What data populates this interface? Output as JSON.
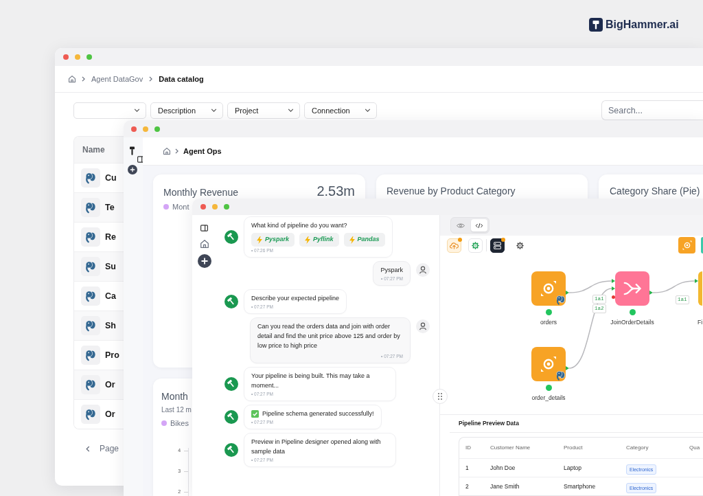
{
  "brand": {
    "name": "BigHammer.ai"
  },
  "data_catalog_window": {
    "breadcrumb": [
      {
        "label": "Agent DataGov",
        "current": false
      },
      {
        "label": "Data catalog",
        "current": true
      }
    ],
    "filters": [
      {
        "kind": "blank"
      },
      {
        "kind": "labeled",
        "label": "Description"
      },
      {
        "kind": "labeled",
        "label": "Project"
      },
      {
        "kind": "labeled",
        "label": "Connection"
      }
    ],
    "search": {
      "placeholder": "Search..."
    },
    "table": {
      "columns": [
        "Name"
      ],
      "rows": [
        {
          "name": "Cu"
        },
        {
          "name": "Te"
        },
        {
          "name": "Re"
        },
        {
          "name": "Su"
        },
        {
          "name": "Ca"
        },
        {
          "name": "Sh"
        },
        {
          "name": "Pro"
        },
        {
          "name": "Or"
        },
        {
          "name": "Or"
        }
      ]
    },
    "pagination": {
      "label": "Page"
    }
  },
  "agent_ops_window": {
    "breadcrumb": [
      {
        "label": "Agent Ops",
        "current": true
      }
    ],
    "cards": [
      {
        "title": "Monthly Revenue",
        "value": "2.53m",
        "legend": [
          "Mont"
        ]
      },
      {
        "title": "Revenue by Product Category"
      },
      {
        "title": "Category Share (Pie)"
      },
      {
        "title": "Month",
        "subtitle": "Last 12 m",
        "legend": [
          "Bikes"
        ],
        "axis_ticks": [
          "4",
          "3",
          "2"
        ]
      }
    ]
  },
  "pipeline_window": {
    "chat": {
      "messages": [
        {
          "kind": "bot",
          "text": "What kind of pipeline do you want?",
          "options": [
            "Pyspark",
            "Pyflink",
            "Pandas"
          ],
          "time": "• 07:26 PM",
          "success": false
        },
        {
          "kind": "user",
          "text": "Pyspark",
          "time": "• 07:27 PM",
          "success": false
        },
        {
          "kind": "bot",
          "text": "Describe your expected pipeline",
          "time": "• 07:27 PM",
          "success": false
        },
        {
          "kind": "user",
          "text": "Can you read the orders data and join with order detail and find the unit price above 125 and order by low price to high price",
          "time": "• 07:27 PM",
          "success": false
        },
        {
          "kind": "bot",
          "text": "Your pipeline is being built. This may take a moment...",
          "time": "• 07:27 PM",
          "success": false
        },
        {
          "kind": "bot",
          "text": "Pipeline schema generated successfully!",
          "time": "• 07:27 PM",
          "success": true
        },
        {
          "kind": "bot",
          "text": "Preview in Pipeline designer opened along with sample data",
          "time": "• 07:27 PM",
          "success": false
        }
      ]
    },
    "view_toggle": [
      {
        "kind": "preview",
        "selected": false
      },
      {
        "kind": "code",
        "selected": true
      }
    ],
    "toolbar": [
      {
        "kind": "upload",
        "badge": true
      },
      {
        "kind": "process",
        "badge": false
      },
      {
        "kind": "server",
        "badge": true
      },
      {
        "kind": "settings",
        "badge": false
      }
    ],
    "palette": [
      {
        "kind": "source"
      },
      {
        "kind": "other"
      }
    ],
    "canvas": {
      "nodes": [
        {
          "kind": "source",
          "label": "orders"
        },
        {
          "kind": "join",
          "label": "JoinOrderDetails"
        },
        {
          "kind": "other",
          "label": "Fi"
        },
        {
          "kind": "source",
          "label": "order_details"
        }
      ],
      "edges": [
        {
          "label": "1a1"
        },
        {
          "label": "1a2"
        },
        {
          "label": "1a1"
        }
      ]
    },
    "preview": {
      "title": "Pipeline Preview Data",
      "columns": [
        "ID",
        "Customer Name",
        "Product",
        "Category",
        "Qua"
      ],
      "rows": [
        {
          "id": "1",
          "customer_name": "John Doe",
          "product": "Laptop",
          "category": "Electronics"
        },
        {
          "id": "2",
          "customer_name": "Jane Smith",
          "product": "Smartphone",
          "category": "Electronics"
        }
      ]
    }
  }
}
